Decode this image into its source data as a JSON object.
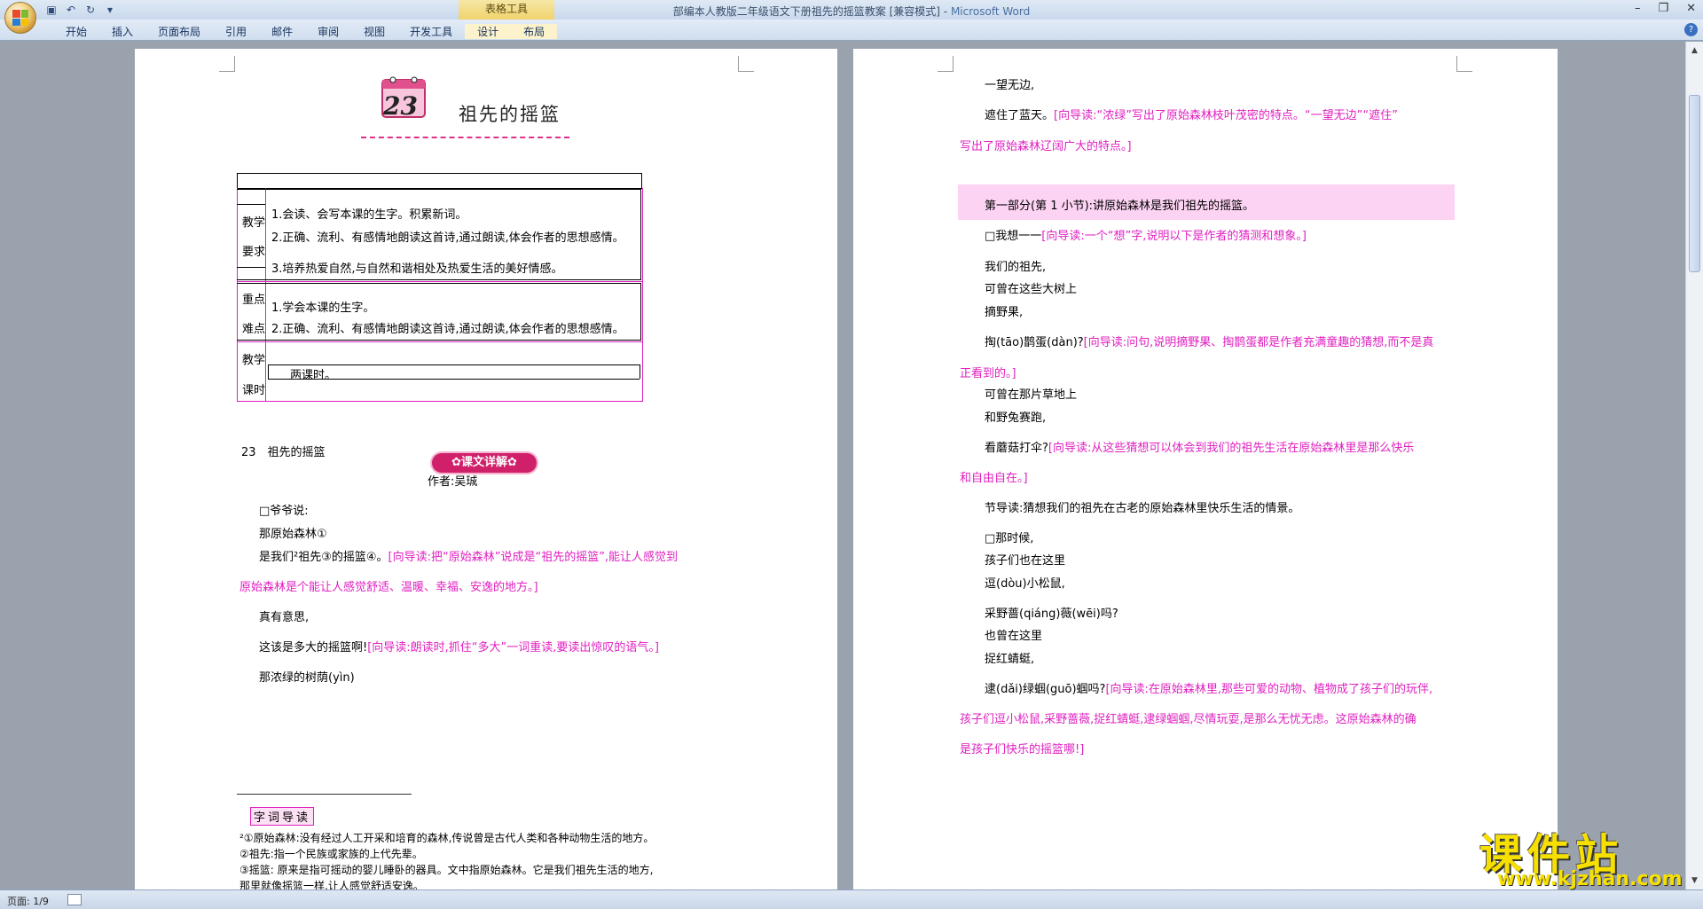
{
  "window": {
    "title": "部编本人教版二年级语文下册祖先的摇篮教案 [兼容模式]",
    "app_name": "Microsoft Word",
    "context_tab_group": "表格工具"
  },
  "ribbon": {
    "tabs": [
      "开始",
      "插入",
      "页面布局",
      "引用",
      "邮件",
      "审阅",
      "视图",
      "开发工具",
      "设计",
      "布局"
    ]
  },
  "status": {
    "page": "页面: 1/9"
  },
  "left_page": {
    "lesson_number": "23",
    "lesson_title": "祖先的摇篮",
    "table": {
      "row1_label_a": "教学",
      "row1_label_b": "要求",
      "row1_items": [
        "1.会读、会写本课的生字。积累新词。",
        "2.正确、流利、有感情地朗读这首诗,通过朗读,体会作者的思想感情。",
        "3.培养热爱自然,与自然和谐相处及热爱生活的美好情感。"
      ],
      "row2_label_a": "重点",
      "row2_label_b": "难点",
      "row2_items": [
        "1.学会本课的生字。",
        "2.正确、流利、有感情地朗读这首诗,通过朗读,体会作者的思想感情。"
      ],
      "row3_label_a": "教学",
      "row3_label_b": "课时",
      "row3_value": "两课时。"
    },
    "section_banner": "✿课文详解✿",
    "heading": "23　祖先的摇篮",
    "author": "作者:吴珹",
    "lines": [
      {
        "text": "□爷爷说:",
        "note": ""
      },
      {
        "text": "那原始森林①",
        "note": ""
      },
      {
        "text": "是我们²祖先③的摇篮④。",
        "note": "[向导读:把“原始森林”说成是“祖先的摇篮”,能让人感觉到"
      },
      {
        "text": "",
        "note": "原始森林是个能让人感觉舒适、温暖、幸福、安逸的地方。]"
      },
      {
        "text": "真有意思,",
        "note": ""
      },
      {
        "text": "这该是多大的摇篮啊!",
        "note": "[向导读:朗读时,抓住“多大”一词重读,要读出惊叹的语气。]"
      },
      {
        "text": "那浓绿的树荫(yìn)",
        "note": ""
      }
    ],
    "vocab_tag": "字词导读",
    "footnotes": [
      "²①原始森林:没有经过人工开采和培育的森林,传说曾是古代人类和各种动物生活的地方。",
      "②祖先:指一个民族或家族的上代先辈。",
      "③摇篮: 原来是指可摇动的婴儿睡卧的器具。文中指原始森林。它是我们祖先生活的地方,",
      "那里就像摇篮一样,让人感觉舒适安逸。"
    ]
  },
  "right_page": {
    "lines": [
      {
        "text": "一望无边,",
        "note": ""
      },
      {
        "text": "遮住了蓝天。",
        "note": "[向导读:“浓绿”写出了原始森林枝叶茂密的特点。“一望无边”“遮住”"
      },
      {
        "text": "",
        "note": "写出了原始森林辽阔广大的特点。]"
      },
      {
        "text": "第一部分(第 1 小节):讲原始森林是我们祖先的摇篮。",
        "note": ""
      },
      {
        "text": "□我想一一",
        "note": "[向导读:一个“想”字,说明以下是作者的猜测和想象。]"
      },
      {
        "text": "我们的祖先,",
        "note": ""
      },
      {
        "text": "可曾在这些大树上",
        "note": ""
      },
      {
        "text": "摘野果,",
        "note": ""
      },
      {
        "text": "掏(tāo)鹊蛋(dàn)?",
        "note": "[向导读:问句,说明摘野果、掏鹊蛋都是作者充满童趣的猜想,而不是真"
      },
      {
        "text": "",
        "note": "正看到的。]"
      },
      {
        "text": "可曾在那片草地上",
        "note": ""
      },
      {
        "text": "和野兔赛跑,",
        "note": ""
      },
      {
        "text": "看蘑菇打伞?",
        "note": "[向导读:从这些猜想可以体会到我们的祖先生活在原始森林里是那么快乐"
      },
      {
        "text": "",
        "note": "和自由自在。]"
      },
      {
        "text": "节导读:猜想我们的祖先在古老的原始森林里快乐生活的情景。",
        "note": ""
      },
      {
        "text": "□那时候,",
        "note": ""
      },
      {
        "text": "孩子们也在这里",
        "note": ""
      },
      {
        "text": "逗(dòu)小松鼠,",
        "note": ""
      },
      {
        "text": "采野蔷(qiáng)薇(wēi)吗?",
        "note": ""
      },
      {
        "text": "也曾在这里",
        "note": ""
      },
      {
        "text": "捉红蜻蜓,",
        "note": ""
      },
      {
        "text": "逮(dǎi)绿蝈(guō)蝈吗?",
        "note": "[向导读:在原始森林里,那些可爱的动物、植物成了孩子们的玩伴,"
      },
      {
        "text": "",
        "note": "孩子们逗小松鼠,采野蔷薇,捉红蜻蜓,逮绿蝈蝈,尽情玩耍,是那么无忧无虑。这原始森林的确"
      },
      {
        "text": "",
        "note": "是孩子们快乐的摇篮哪!]"
      }
    ]
  },
  "watermark": {
    "text": "课件站",
    "url": "www.kjzhan.com"
  }
}
